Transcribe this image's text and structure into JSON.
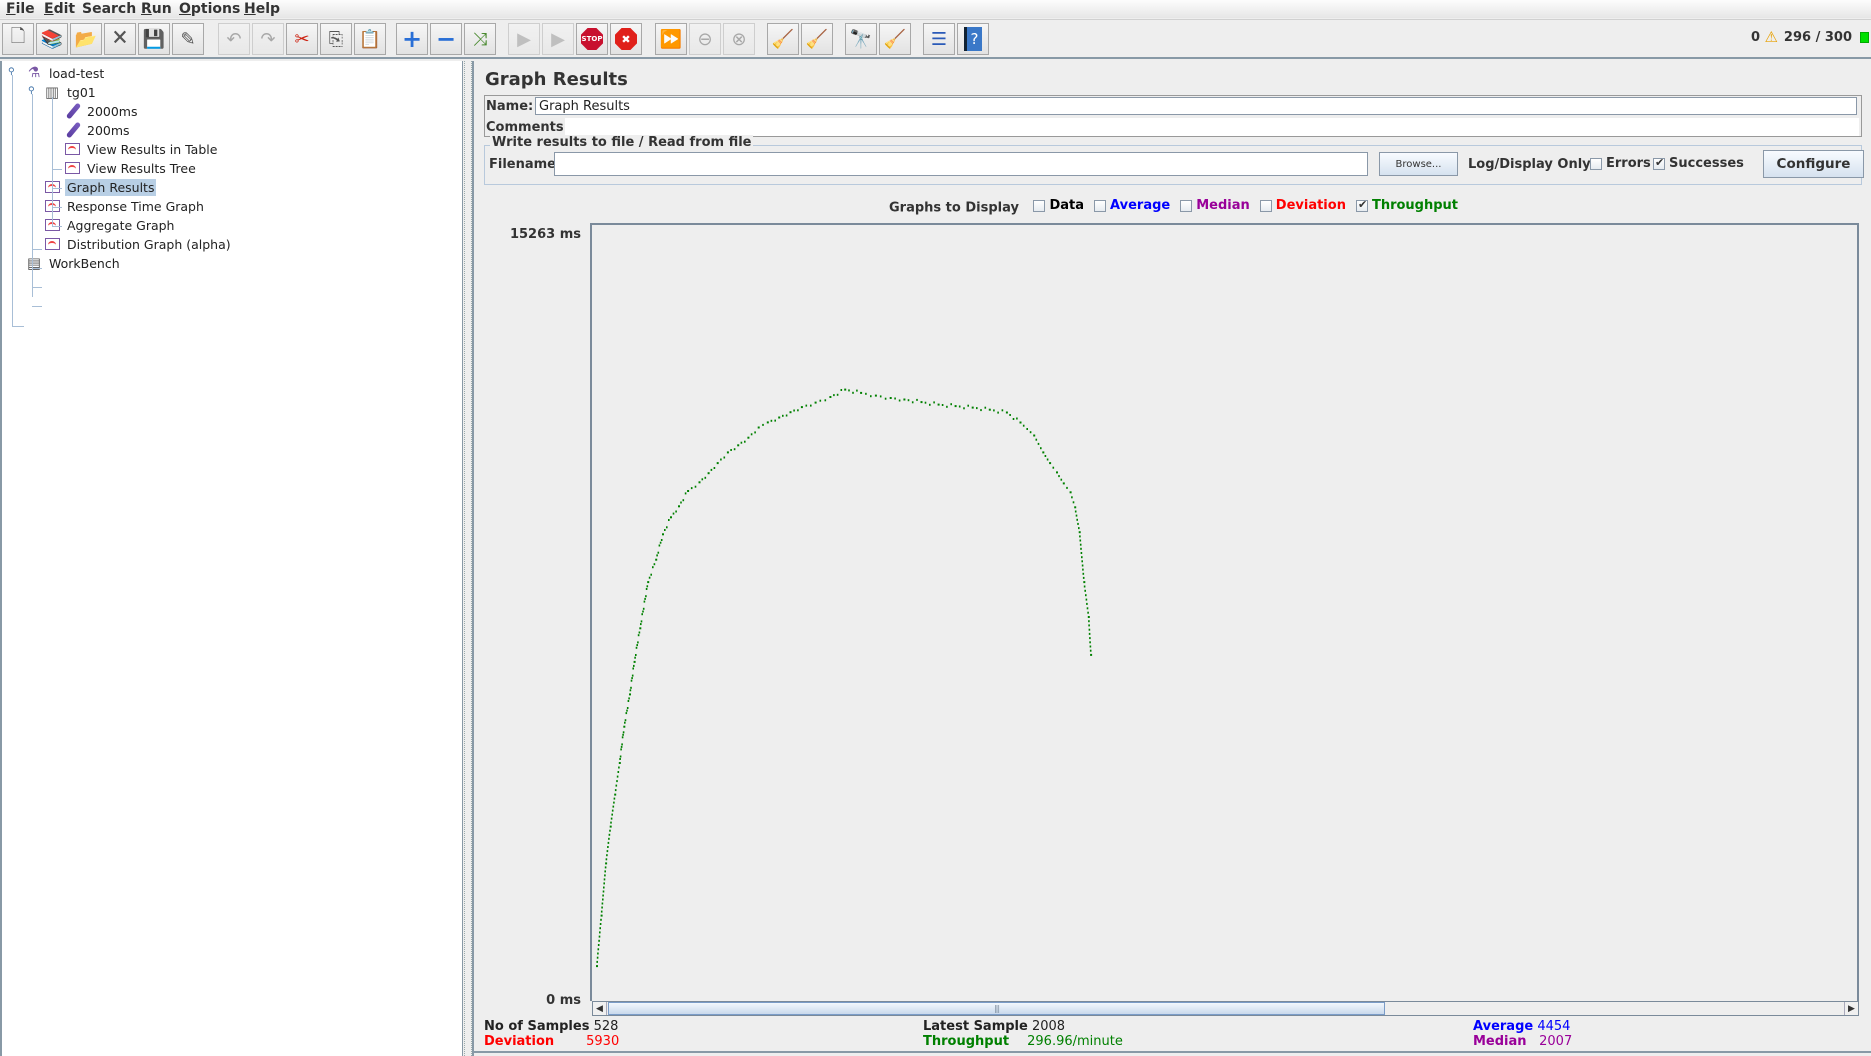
{
  "menubar": {
    "items": [
      {
        "label": "File",
        "mnemonic": "F",
        "rest": "ile"
      },
      {
        "label": "Edit",
        "mnemonic": "E",
        "rest": "dit"
      },
      {
        "label": "Search",
        "mnemonic": "",
        "rest": "Search"
      },
      {
        "label": "Run",
        "mnemonic": "R",
        "rest": "un"
      },
      {
        "label": "Options",
        "mnemonic": "O",
        "rest": "ptions"
      },
      {
        "label": "Help",
        "mnemonic": "H",
        "rest": "elp"
      }
    ]
  },
  "toolbar": {
    "buttons": [
      {
        "name": "new-icon",
        "glyph": "🗋",
        "enabled": true
      },
      {
        "name": "templates-icon",
        "glyph": "📚",
        "enabled": true
      },
      {
        "name": "open-icon",
        "glyph": "📂",
        "enabled": true
      },
      {
        "name": "close-icon",
        "glyph": "🗙",
        "enabled": true
      },
      {
        "name": "save-icon",
        "glyph": "💾",
        "enabled": true
      },
      {
        "name": "save-as-icon",
        "glyph": "✎",
        "enabled": true
      },
      {
        "name": "undo-icon",
        "glyph": "↶",
        "enabled": false
      },
      {
        "name": "redo-icon",
        "glyph": "↷",
        "enabled": false
      },
      {
        "name": "cut-icon",
        "glyph": "✂",
        "enabled": true
      },
      {
        "name": "copy-icon",
        "glyph": "⎘",
        "enabled": true
      },
      {
        "name": "paste-icon",
        "glyph": "📋",
        "enabled": true
      },
      {
        "name": "expand-icon",
        "glyph": "+",
        "enabled": true
      },
      {
        "name": "collapse-icon",
        "glyph": "−",
        "enabled": true
      },
      {
        "name": "toggle-icon",
        "glyph": "⤨",
        "enabled": true
      },
      {
        "name": "start-icon",
        "glyph": "▶",
        "enabled": false
      },
      {
        "name": "start-no-pauses-icon",
        "glyph": "▶",
        "enabled": false
      },
      {
        "name": "stop-icon",
        "glyph": "STOP",
        "enabled": true
      },
      {
        "name": "shutdown-icon",
        "glyph": "✖",
        "enabled": true
      },
      {
        "name": "remote-start-all-icon",
        "glyph": "⏩",
        "enabled": true
      },
      {
        "name": "remote-stop-all-icon",
        "glyph": "⊖",
        "enabled": false
      },
      {
        "name": "remote-shutdown-all-icon",
        "glyph": "⊗",
        "enabled": false
      },
      {
        "name": "clear-icon",
        "glyph": "🧹",
        "enabled": true
      },
      {
        "name": "clear-all-icon",
        "glyph": "🧹",
        "enabled": true
      },
      {
        "name": "search-icon",
        "glyph": "🔭",
        "enabled": true
      },
      {
        "name": "reset-search-icon",
        "glyph": "🧹",
        "enabled": true
      },
      {
        "name": "function-helper-icon",
        "glyph": "☰",
        "enabled": true
      },
      {
        "name": "help-icon",
        "glyph": "?",
        "enabled": true
      }
    ],
    "error_count": "0",
    "threads": "296 / 300"
  },
  "tree": {
    "items": [
      {
        "label": "load-test",
        "icon": "test-plan-icon",
        "level": 0
      },
      {
        "label": "tg01",
        "icon": "thread-group-icon",
        "level": 1
      },
      {
        "label": "2000ms",
        "icon": "sampler-icon",
        "level": 2
      },
      {
        "label": "200ms",
        "icon": "sampler-icon",
        "level": 2
      },
      {
        "label": "View Results in Table",
        "icon": "listener-icon",
        "level": 2
      },
      {
        "label": "View Results Tree",
        "icon": "listener-icon",
        "level": 2
      },
      {
        "label": "Graph Results",
        "icon": "listener-icon",
        "level": 1,
        "selected": true
      },
      {
        "label": "Response Time Graph",
        "icon": "listener-icon",
        "level": 1
      },
      {
        "label": "Aggregate Graph",
        "icon": "listener-icon",
        "level": 1
      },
      {
        "label": "Distribution Graph (alpha)",
        "icon": "listener-icon",
        "level": 1
      },
      {
        "label": "WorkBench",
        "icon": "workbench-icon",
        "level": 0
      }
    ]
  },
  "panel": {
    "title": "Graph Results",
    "name_label": "Name:",
    "name_value": "Graph Results",
    "comments_label": "Comments:",
    "comments_value": "",
    "file_section_title": "Write results to file / Read from file",
    "filename_label": "Filename",
    "filename_value": "",
    "browse_label": "Browse...",
    "log_display_label": "Log/Display Only:",
    "errors_label": "Errors",
    "errors_checked": false,
    "successes_label": "Successes",
    "successes_checked": true,
    "configure_label": "Configure"
  },
  "graphs_to_display": {
    "label": "Graphs to Display",
    "options": [
      {
        "label": "Data",
        "checked": false,
        "color": "#000000"
      },
      {
        "label": "Average",
        "checked": false,
        "color": "#0000ff"
      },
      {
        "label": "Median",
        "checked": false,
        "color": "#990099"
      },
      {
        "label": "Deviation",
        "checked": false,
        "color": "#ff0000"
      },
      {
        "label": "Throughput",
        "checked": true,
        "color": "#008000"
      }
    ]
  },
  "stats": {
    "samples_label": "No of Samples",
    "samples_value": "528",
    "deviation_label": "Deviation",
    "deviation_value": "5930",
    "latest_label": "Latest Sample",
    "latest_value": "2008",
    "throughput_label": "Throughput",
    "throughput_value": "296.96/minute",
    "average_label": "Average",
    "average_value": "4454",
    "median_label": "Median",
    "median_value": "2007"
  },
  "chart_data": {
    "type": "scatter",
    "title": "",
    "xlabel": "",
    "ylabel": "",
    "y_max_label": "15263 ms",
    "y_min_label": "0 ms",
    "ylim": [
      0,
      15263
    ],
    "x_visible_fraction": 0.62,
    "series": [
      {
        "name": "Throughput",
        "color": "#008000",
        "x": [
          0,
          4,
          8,
          12,
          16,
          20,
          24,
          29,
          33,
          38,
          45,
          52,
          58,
          65,
          72,
          80,
          90,
          98,
          106,
          115,
          124,
          133,
          142,
          150,
          160,
          170,
          180,
          192,
          205,
          218,
          232,
          245,
          258,
          270,
          285,
          300,
          315,
          330,
          345,
          360,
          372,
          384,
          392,
          398,
          404,
          410,
          416,
          420,
          424,
          428,
          432,
          434
        ],
        "values": [
          706,
          1700,
          2727,
          3450,
          4080,
          4700,
          5414,
          6050,
          6690,
          7350,
          8258,
          8700,
          9200,
          9534,
          9750,
          10050,
          10221,
          10400,
          10600,
          10810,
          10950,
          11100,
          11300,
          11400,
          11496,
          11600,
          11700,
          11790,
          11900,
          12045,
          11980,
          11928,
          11880,
          11850,
          11800,
          11751,
          11720,
          11692,
          11650,
          11594,
          11398,
          11143,
          10810,
          10600,
          10417,
          10200,
          10025,
          9730,
          9240,
          8259,
          7572,
          6827
        ]
      }
    ]
  }
}
